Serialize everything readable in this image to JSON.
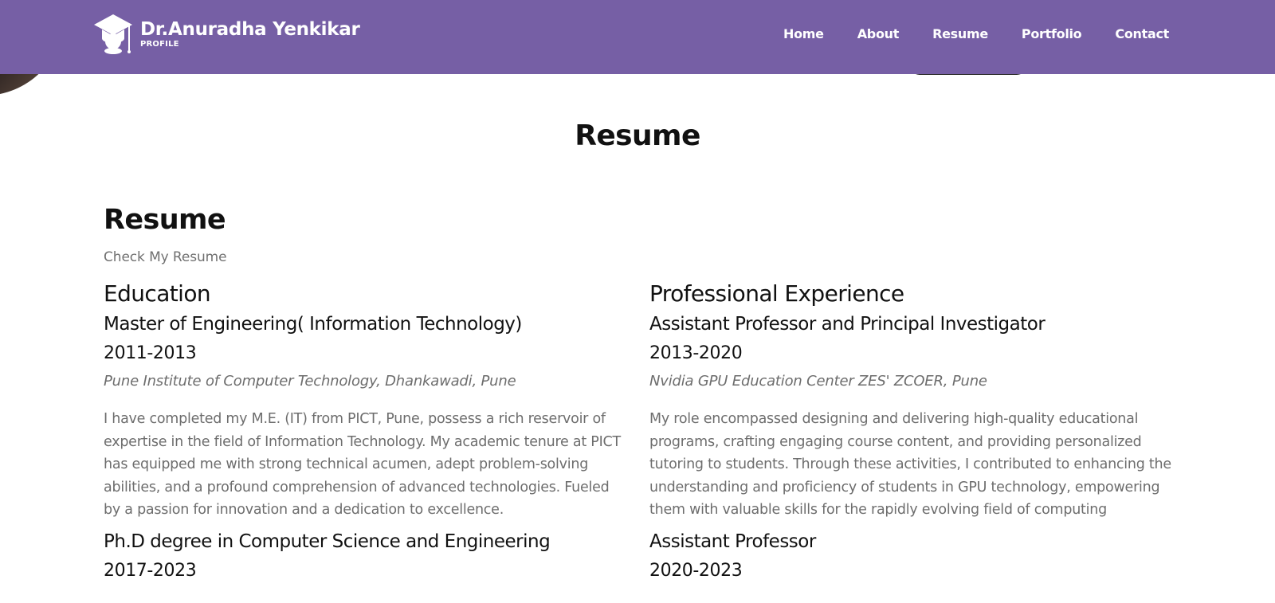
{
  "header": {
    "logo_title": "Dr.Anuradha Yenkikar",
    "logo_subtitle": "PROFILE",
    "logo_icon": "graduation-cap-icon",
    "brand_color": "#765fa5",
    "nav": [
      {
        "label": "Home"
      },
      {
        "label": "About"
      },
      {
        "label": "Resume"
      },
      {
        "label": "Portfolio"
      },
      {
        "label": "Contact"
      }
    ]
  },
  "section": {
    "title": "Resume"
  },
  "resume": {
    "heading": "Resume",
    "subheading": "Check My Resume"
  },
  "education": {
    "title": "Education",
    "items": [
      {
        "title": "Master of Engineering( Information Technology)",
        "years": "2011-2013",
        "place": "Pune Institute of Computer Technology, Dhankawadi, Pune",
        "description": "I have completed my M.E. (IT) from PICT, Pune, possess a rich reservoir of expertise in the field of Information Technology. My academic tenure at PICT has equipped me with strong technical acumen, adept problem-solving abilities, and a profound comprehension of advanced technologies. Fueled by a passion for innovation and a dedication to excellence."
      },
      {
        "title": "Ph.D degree in Computer Science and Engineering",
        "years": "2017-2023"
      }
    ]
  },
  "experience": {
    "title": "Professional Experience",
    "items": [
      {
        "title": "Assistant Professor and Principal Investigator",
        "years": "2013-2020",
        "place": "Nvidia GPU Education Center ZES' ZCOER, Pune",
        "description": "My role encompassed designing and delivering high-quality educational programs, crafting engaging course content, and providing personalized tutoring to students. Through these activities, I contributed to enhancing the understanding and proficiency of students in GPU technology, empowering them with valuable skills for the rapidly evolving field of computing"
      },
      {
        "title": "Assistant Professor",
        "years": "2020-2023"
      }
    ]
  }
}
